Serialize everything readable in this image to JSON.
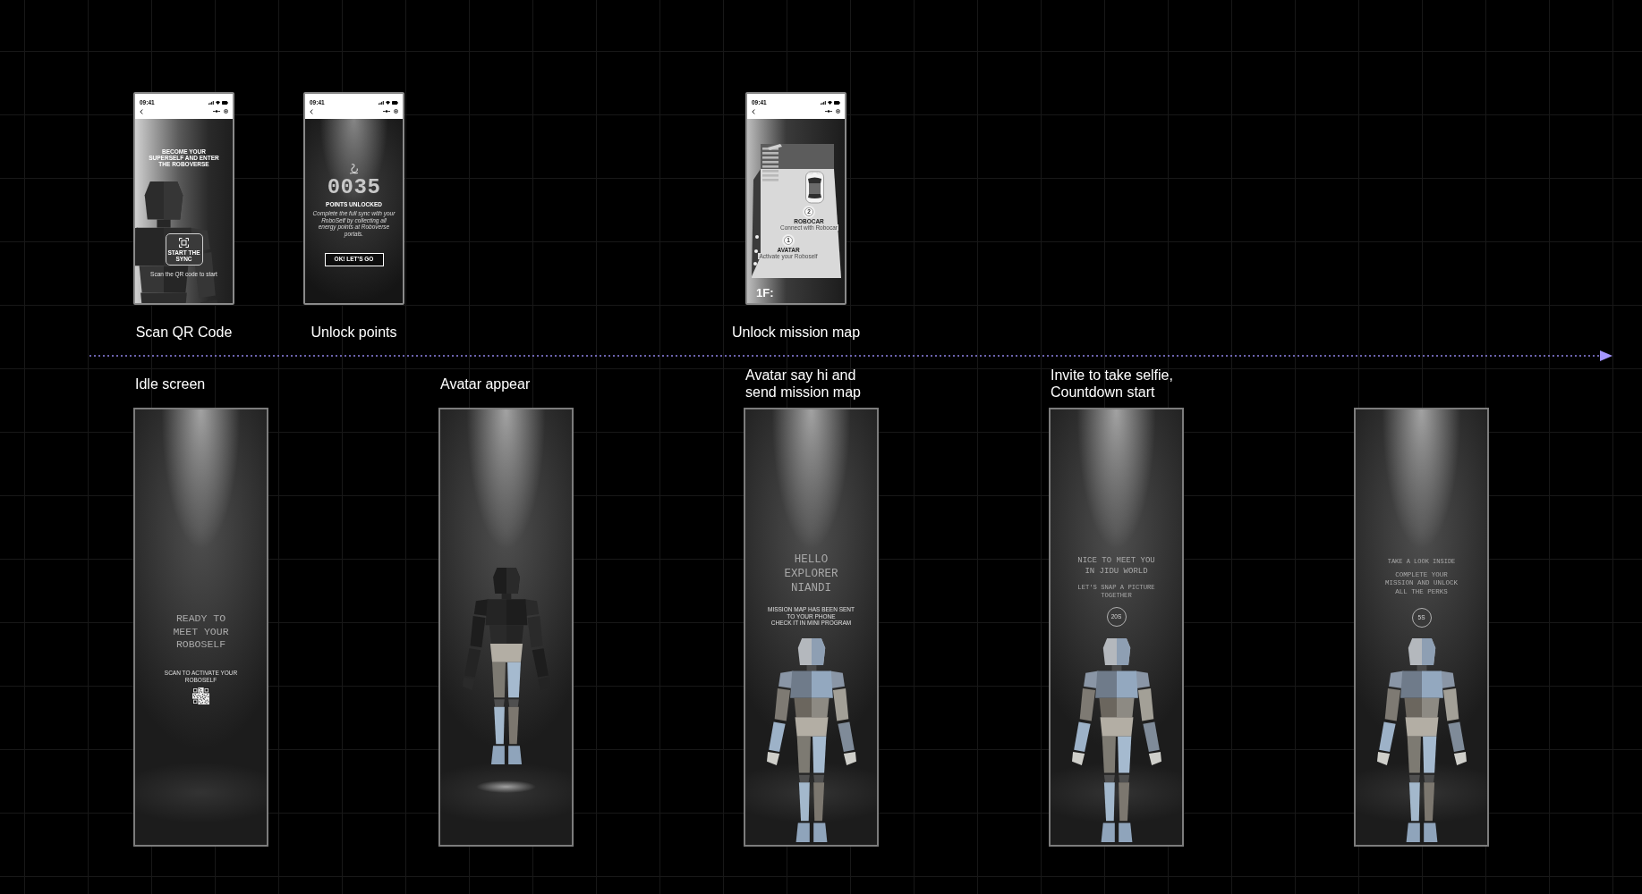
{
  "phone_screens": [
    {
      "kind": "scan",
      "status_time": "09:41",
      "headline": "BECOME YOUR SUPERSELF AND ENTER THE ROBOVERSE",
      "button_label": "START THE\nSYNC",
      "hint": "Scan the QR code to start",
      "caption": "Scan QR Code"
    },
    {
      "kind": "points",
      "status_time": "09:41",
      "points": "0035",
      "points_label": "POINTS UNLOCKED",
      "message": "Complete the full sync with your\nRoboSelf by collecting all\nenergy points at Roboverse\nportals.",
      "button_label": "OK! LET'S GO",
      "caption": "Unlock points"
    },
    {
      "kind": "map",
      "status_time": "09:41",
      "spots": [
        {
          "number": "2",
          "title": "ROBOCAR",
          "subtitle": "Connect with Robocar"
        },
        {
          "number": "1",
          "title": "AVATAR",
          "subtitle": "Activate your Roboself"
        }
      ],
      "floor_label": "1F:",
      "caption": "Unlock mission map"
    }
  ],
  "kiosk_screens": [
    {
      "kind": "idle",
      "caption": "Idle screen",
      "headline": "READY TO\nMEET YOUR\nROBOSELF",
      "message": "SCAN TO ACTIVATE YOUR\nROBOSELF"
    },
    {
      "kind": "appear",
      "caption": "Avatar appear"
    },
    {
      "kind": "greeting",
      "caption": "Avatar say hi and send mission map",
      "headline": "HELLO\nEXPLORER\nNIANDI",
      "message": "MISSION MAP HAS BEEN SENT\nTO YOUR PHONE\nCHECK IT IN MINI PROGRAM"
    },
    {
      "kind": "selfie",
      "caption": "Invite to take selfie, Countdown start",
      "headline": "NICE TO MEET YOU\nIN JIDU WORLD",
      "message": "LET'S SNAP A PICTURE\nTOGETHER",
      "countdown": "20S"
    },
    {
      "kind": "explore",
      "headline": "TAKE A LOOK INSIDE",
      "message": "COMPLETE YOUR\nMISSION AND UNLOCK\nALL THE PERKS",
      "countdown": "5S"
    }
  ]
}
